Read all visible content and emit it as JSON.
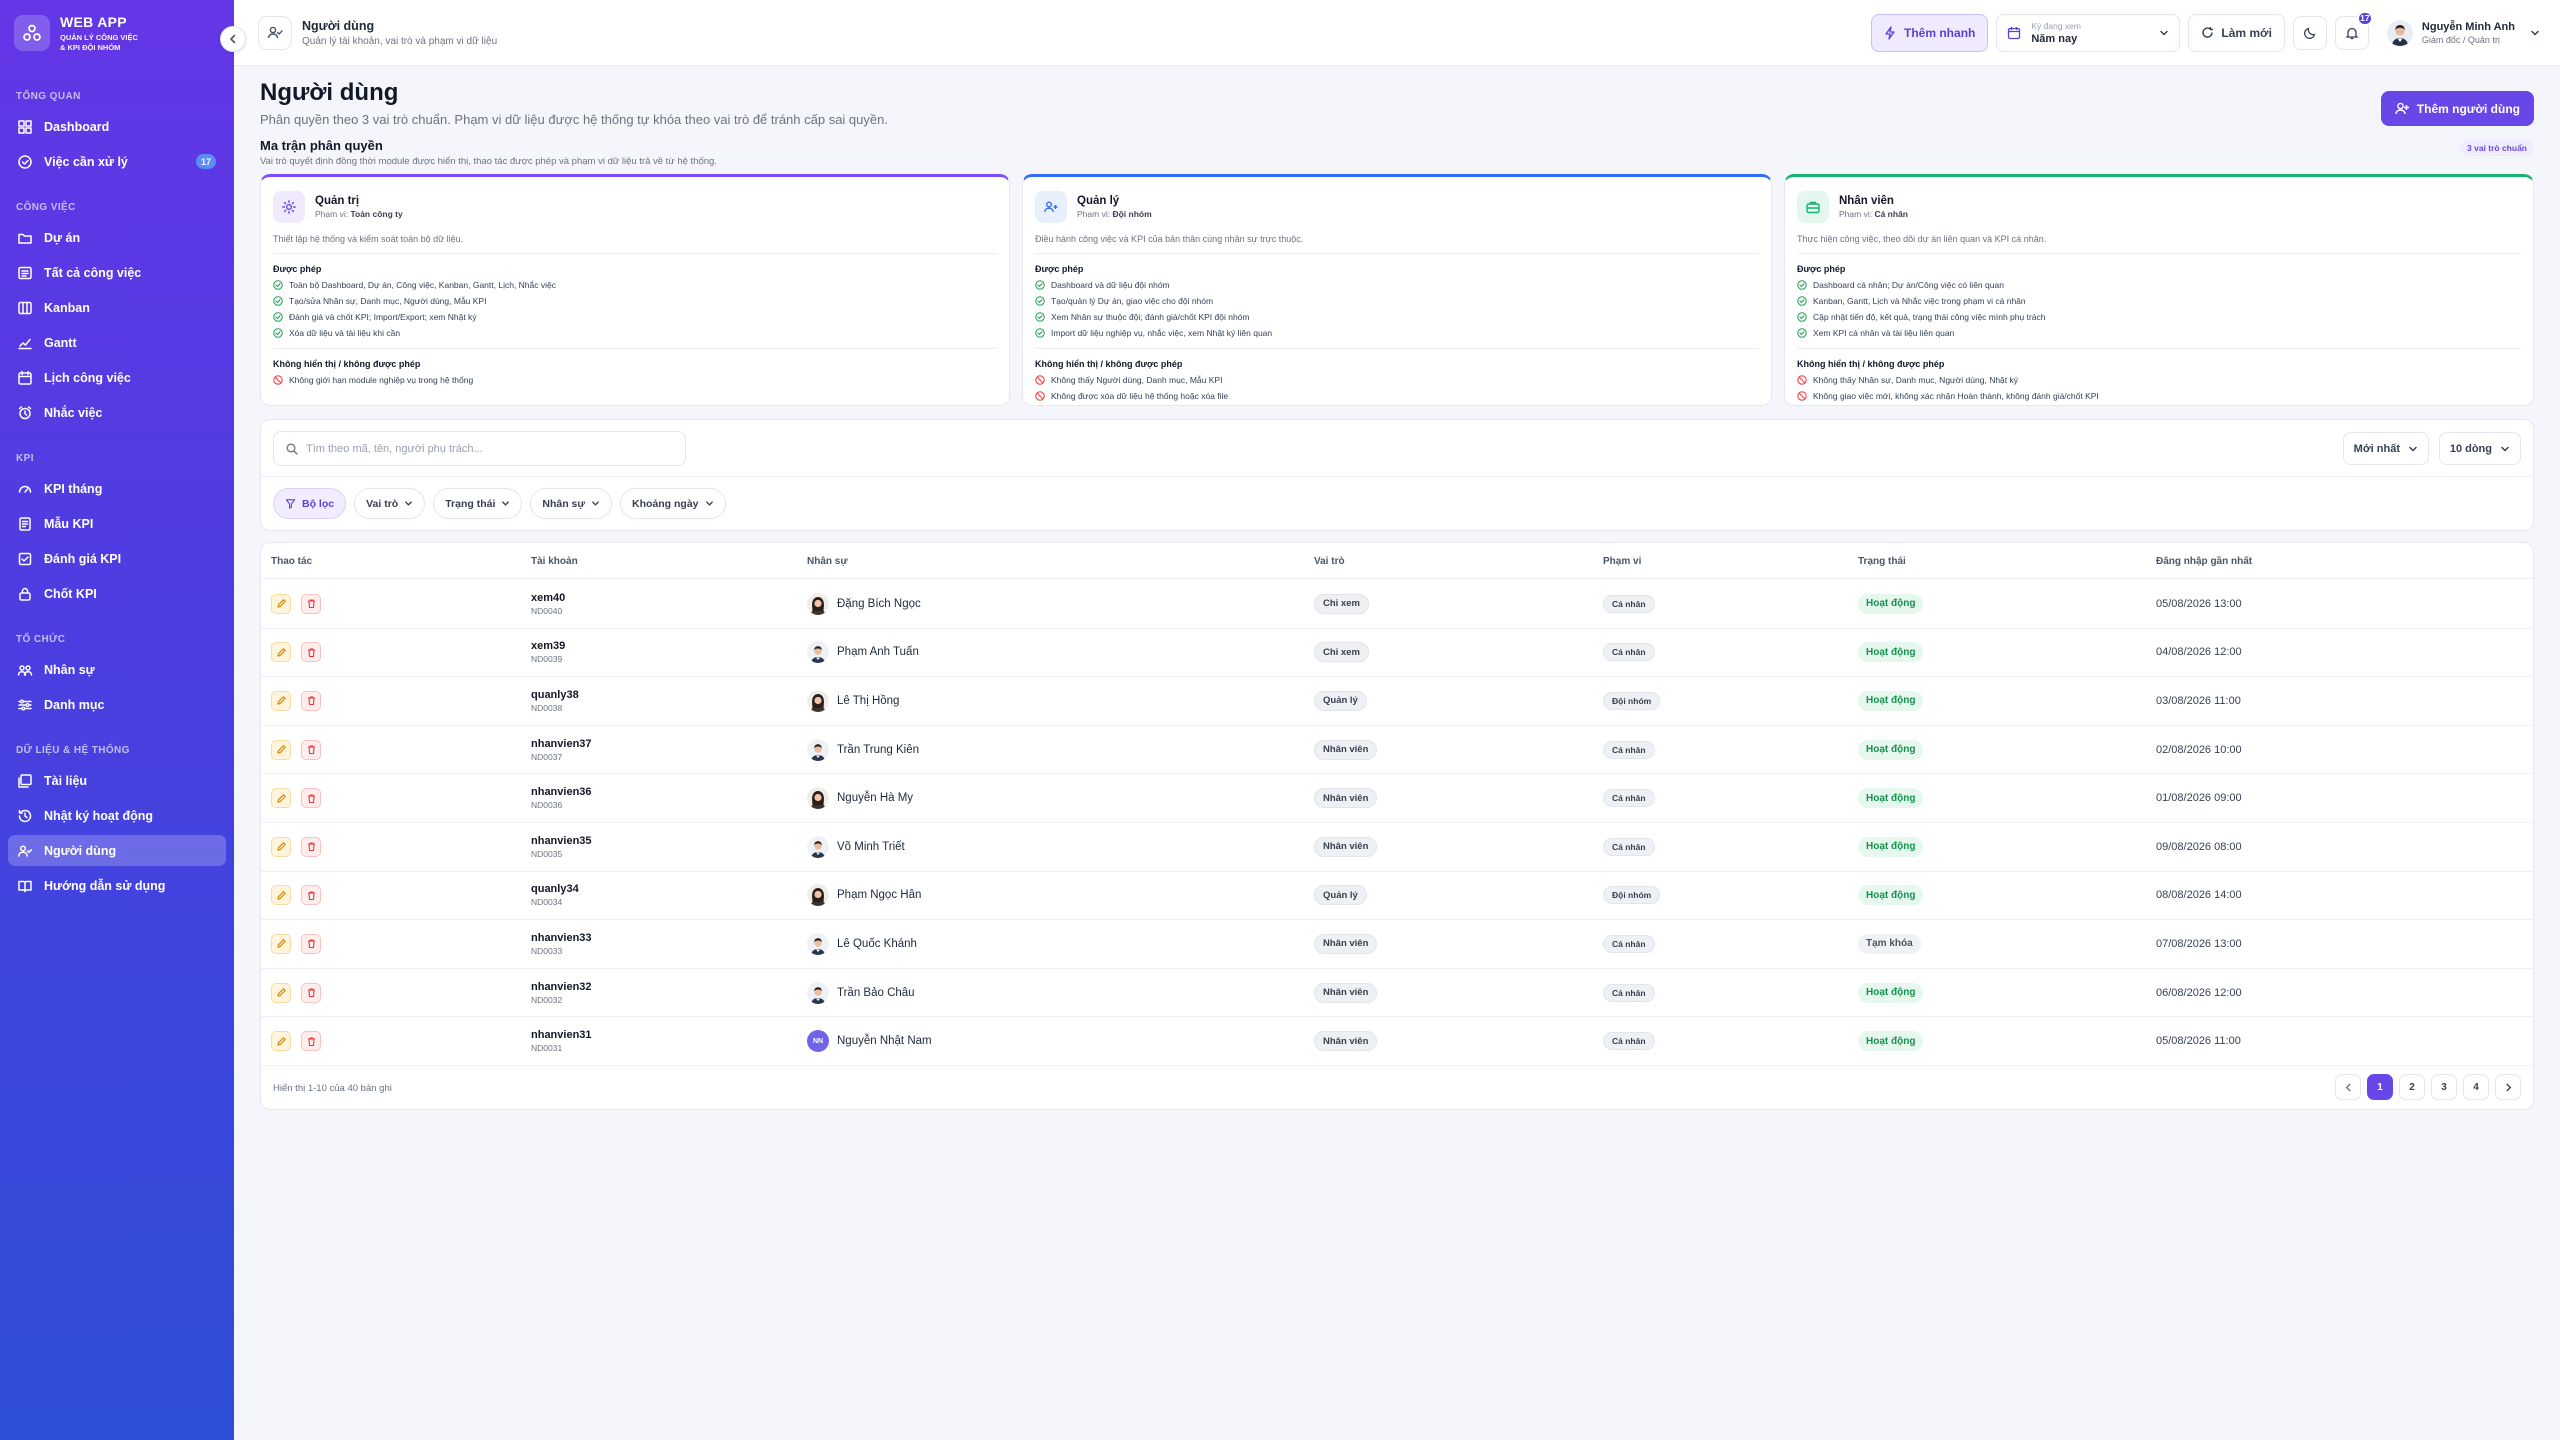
{
  "brand": {
    "title": "WEB APP",
    "sub1": "QUẢN LÝ CÔNG VIỆC",
    "sub2": "& KPI ĐỘI NHÓM"
  },
  "sidebar": {
    "sections": [
      {
        "label": "TỔNG QUAN",
        "items": [
          {
            "label": "Dashboard",
            "icon": "dashboard-icon"
          },
          {
            "label": "Việc cần xử lý",
            "icon": "task-check-icon",
            "badge": "17"
          }
        ]
      },
      {
        "label": "CÔNG VIỆC",
        "items": [
          {
            "label": "Dự án",
            "icon": "folder-icon"
          },
          {
            "label": "Tất cả công việc",
            "icon": "list-icon"
          },
          {
            "label": "Kanban",
            "icon": "kanban-icon"
          },
          {
            "label": "Gantt",
            "icon": "gantt-icon"
          },
          {
            "label": "Lịch công việc",
            "icon": "calendar-icon"
          },
          {
            "label": "Nhắc việc",
            "icon": "alarm-icon"
          }
        ]
      },
      {
        "label": "KPI",
        "items": [
          {
            "label": "KPI tháng",
            "icon": "gauge-icon"
          },
          {
            "label": "Mẫu KPI",
            "icon": "template-icon"
          },
          {
            "label": "Đánh giá KPI",
            "icon": "evaluate-icon"
          },
          {
            "label": "Chốt KPI",
            "icon": "lock-icon"
          }
        ]
      },
      {
        "label": "TỔ CHỨC",
        "items": [
          {
            "label": "Nhân sự",
            "icon": "people-icon"
          },
          {
            "label": "Danh mục",
            "icon": "sliders-icon"
          }
        ]
      },
      {
        "label": "DỮ LIỆU & HỆ THỐNG",
        "items": [
          {
            "label": "Tài liệu",
            "icon": "documents-icon"
          },
          {
            "label": "Nhật ký hoạt động",
            "icon": "history-icon"
          },
          {
            "label": "Người dùng",
            "icon": "users-icon",
            "active": true
          },
          {
            "label": "Hướng dẫn sử dụng",
            "icon": "book-icon"
          }
        ]
      }
    ]
  },
  "header": {
    "title": "Người dùng",
    "subtitle": "Quản lý tài khoản, vai trò và phạm vi dữ liệu",
    "quick_add": "Thêm nhanh",
    "period_label": "Kỳ đang xem",
    "period_value": "Năm nay",
    "refresh": "Làm mới",
    "notif_count": "17",
    "user_name": "Nguyễn Minh Anh",
    "user_role": "Giám đốc / Quản trị"
  },
  "page": {
    "title": "Người dùng",
    "subtitle": "Phân quyền theo 3 vai trò chuẩn. Phạm vi dữ liệu được hệ thống tự khóa theo vai trò để tránh cấp sai quyền.",
    "add_button": "Thêm người dùng",
    "matrix_title": "Ma trận phân quyền",
    "matrix_sub": "Vai trò quyết định đồng thời module được hiển thị, thao tác được phép và phạm vi dữ liệu trả về từ hệ thống.",
    "matrix_chip": "3 vai trò chuẩn"
  },
  "roles": [
    {
      "name": "Quản trị",
      "scope_label": "Phạm vi:",
      "scope": "Toàn công ty",
      "desc": "Thiết lập hệ thống và kiểm soát toàn bộ dữ liệu.",
      "allowed_label": "Được phép",
      "allowed": [
        "Toàn bộ Dashboard, Dự án, Công việc, Kanban, Gantt, Lịch, Nhắc việc",
        "Tạo/sửa Nhân sự, Danh mục, Người dùng, Mẫu KPI",
        "Đánh giá và chốt KPI; Import/Export; xem Nhật ký",
        "Xóa dữ liệu và tài liệu khi cần"
      ],
      "denied_label": "Không hiển thị / không được phép",
      "denied": [
        "Không giới hạn module nghiệp vụ trong hệ thống"
      ]
    },
    {
      "name": "Quản lý",
      "scope_label": "Phạm vi:",
      "scope": "Đội nhóm",
      "desc": "Điều hành công việc và KPI của bản thân cùng nhân sự trực thuộc.",
      "allowed_label": "Được phép",
      "allowed": [
        "Dashboard và dữ liệu đội nhóm",
        "Tạo/quản lý Dự án, giao việc cho đội nhóm",
        "Xem Nhân sự thuộc đội; đánh giá/chốt KPI đội nhóm",
        "Import dữ liệu nghiệp vụ, nhắc việc, xem Nhật ký liên quan"
      ],
      "denied_label": "Không hiển thị / không được phép",
      "denied": [
        "Không thấy Người dùng, Danh mục, Mẫu KPI",
        "Không được xóa dữ liệu hệ thống hoặc xóa file"
      ]
    },
    {
      "name": "Nhân viên",
      "scope_label": "Phạm vi:",
      "scope": "Cá nhân",
      "desc": "Thực hiện công việc, theo dõi dự án liên quan và KPI cá nhân.",
      "allowed_label": "Được phép",
      "allowed": [
        "Dashboard cá nhân; Dự án/Công việc có liên quan",
        "Kanban, Gantt, Lịch và Nhắc việc trong phạm vi cá nhân",
        "Cập nhật tiến độ, kết quả, trạng thái công việc mình phụ trách",
        "Xem KPI cá nhân và tài liệu liên quan"
      ],
      "denied_label": "Không hiển thị / không được phép",
      "denied": [
        "Không thấy Nhân sự, Danh mục, Người dùng, Nhật ký",
        "Không giao việc mới, không xác nhận Hoàn thành, không đánh giá/chốt KPI"
      ]
    }
  ],
  "filters": {
    "search_placeholder": "Tìm theo mã, tên, người phụ trách...",
    "sort": "Mới nhất",
    "page_size": "10 dòng",
    "chips": [
      "Bộ lọc",
      "Vai trò",
      "Trạng thái",
      "Nhân sự",
      "Khoảng ngày"
    ]
  },
  "table": {
    "columns": [
      "Thao tác",
      "Tài khoản",
      "Nhân sự",
      "Vai trò",
      "Phạm vi",
      "Trạng thái",
      "Đăng nhập gần nhất"
    ],
    "rows": [
      {
        "user": "xem40",
        "code": "ND0040",
        "name": "Đặng Bích Ngọc",
        "gender": "f",
        "role": "Chỉ xem",
        "scope": "Cá nhân",
        "status": "Hoạt động",
        "status_type": "ok",
        "last": "05/08/2026 13:00"
      },
      {
        "user": "xem39",
        "code": "ND0039",
        "name": "Phạm Anh Tuấn",
        "gender": "m",
        "role": "Chỉ xem",
        "scope": "Cá nhân",
        "status": "Hoạt động",
        "status_type": "ok",
        "last": "04/08/2026 12:00"
      },
      {
        "user": "quanly38",
        "code": "ND0038",
        "name": "Lê Thị Hồng",
        "gender": "f",
        "role": "Quản lý",
        "scope": "Đội nhóm",
        "status": "Hoạt động",
        "status_type": "ok",
        "last": "03/08/2026 11:00"
      },
      {
        "user": "nhanvien37",
        "code": "ND0037",
        "name": "Trần Trung Kiên",
        "gender": "m",
        "role": "Nhân viên",
        "scope": "Cá nhân",
        "status": "Hoạt động",
        "status_type": "ok",
        "last": "02/08/2026 10:00"
      },
      {
        "user": "nhanvien36",
        "code": "ND0036",
        "name": "Nguyễn Hà My",
        "gender": "f",
        "role": "Nhân viên",
        "scope": "Cá nhân",
        "status": "Hoạt động",
        "status_type": "ok",
        "last": "01/08/2026 09:00"
      },
      {
        "user": "nhanvien35",
        "code": "ND0035",
        "name": "Võ Minh Triết",
        "gender": "m",
        "role": "Nhân viên",
        "scope": "Cá nhân",
        "status": "Hoạt động",
        "status_type": "ok",
        "last": "09/08/2026 08:00"
      },
      {
        "user": "quanly34",
        "code": "ND0034",
        "name": "Phạm Ngọc Hân",
        "gender": "f",
        "role": "Quản lý",
        "scope": "Đội nhóm",
        "status": "Hoạt động",
        "status_type": "ok",
        "last": "08/08/2026 14:00"
      },
      {
        "user": "nhanvien33",
        "code": "ND0033",
        "name": "Lê Quốc Khánh",
        "gender": "m",
        "role": "Nhân viên",
        "scope": "Cá nhân",
        "status": "Tạm khóa",
        "status_type": "lock",
        "last": "07/08/2026 13:00"
      },
      {
        "user": "nhanvien32",
        "code": "ND0032",
        "name": "Trần Bảo Châu",
        "gender": "m",
        "role": "Nhân viên",
        "scope": "Cá nhân",
        "status": "Hoạt động",
        "status_type": "ok",
        "last": "06/08/2026 12:00"
      },
      {
        "user": "nhanvien31",
        "code": "ND0031",
        "name": "Nguyễn Nhật Nam",
        "gender": "initials",
        "initials": "NN",
        "role": "Nhân viên",
        "scope": "Cá nhân",
        "status": "Hoạt động",
        "status_type": "ok",
        "last": "05/08/2026 11:00"
      }
    ],
    "footer": "Hiển thị 1-10 của 40 bản ghi",
    "pages": [
      "1",
      "2",
      "3",
      "4"
    ],
    "current_page": "1"
  },
  "colors": {
    "primary": "#6847e9",
    "sidebar_top": "#6436e6",
    "sidebar_bottom": "#2e4fd8",
    "success": "#15924f"
  }
}
